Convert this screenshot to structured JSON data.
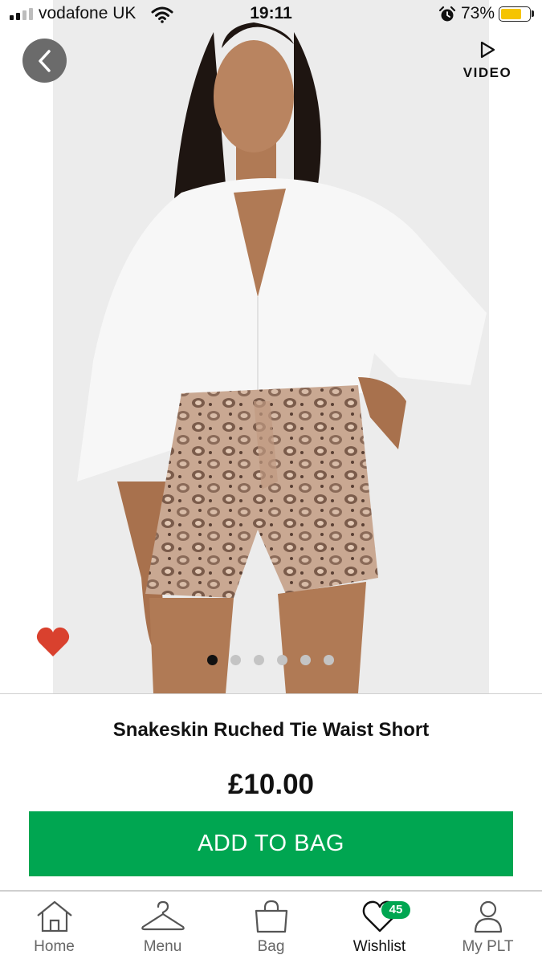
{
  "status_bar": {
    "carrier": "vodafone UK",
    "time": "19:11",
    "battery_percent": "73%",
    "signal_bars": 2,
    "battery_color": "#f5c400"
  },
  "header": {
    "back_icon": "chevron-left-icon",
    "video_icon": "play-icon",
    "video_label": "VIDEO"
  },
  "gallery": {
    "image_count": 6,
    "active_index": 0,
    "favorited": true
  },
  "product": {
    "title": "Snakeskin Ruched Tie Waist Short",
    "price": "£10.00",
    "add_to_bag_label": "ADD TO BAG"
  },
  "tabs": [
    {
      "label": "Home",
      "icon": "home-icon"
    },
    {
      "label": "Menu",
      "icon": "hanger-icon"
    },
    {
      "label": "Bag",
      "icon": "bag-icon"
    },
    {
      "label": "Wishlist",
      "icon": "heart-icon",
      "badge": "45",
      "active": true
    },
    {
      "label": "My PLT",
      "icon": "user-icon"
    }
  ],
  "colors": {
    "accent_green": "#00a651",
    "heart_red": "#d9412e",
    "back_button_bg": "#6b6b6b",
    "dot_active": "#111111",
    "dot_inactive": "#c4c4c4"
  }
}
